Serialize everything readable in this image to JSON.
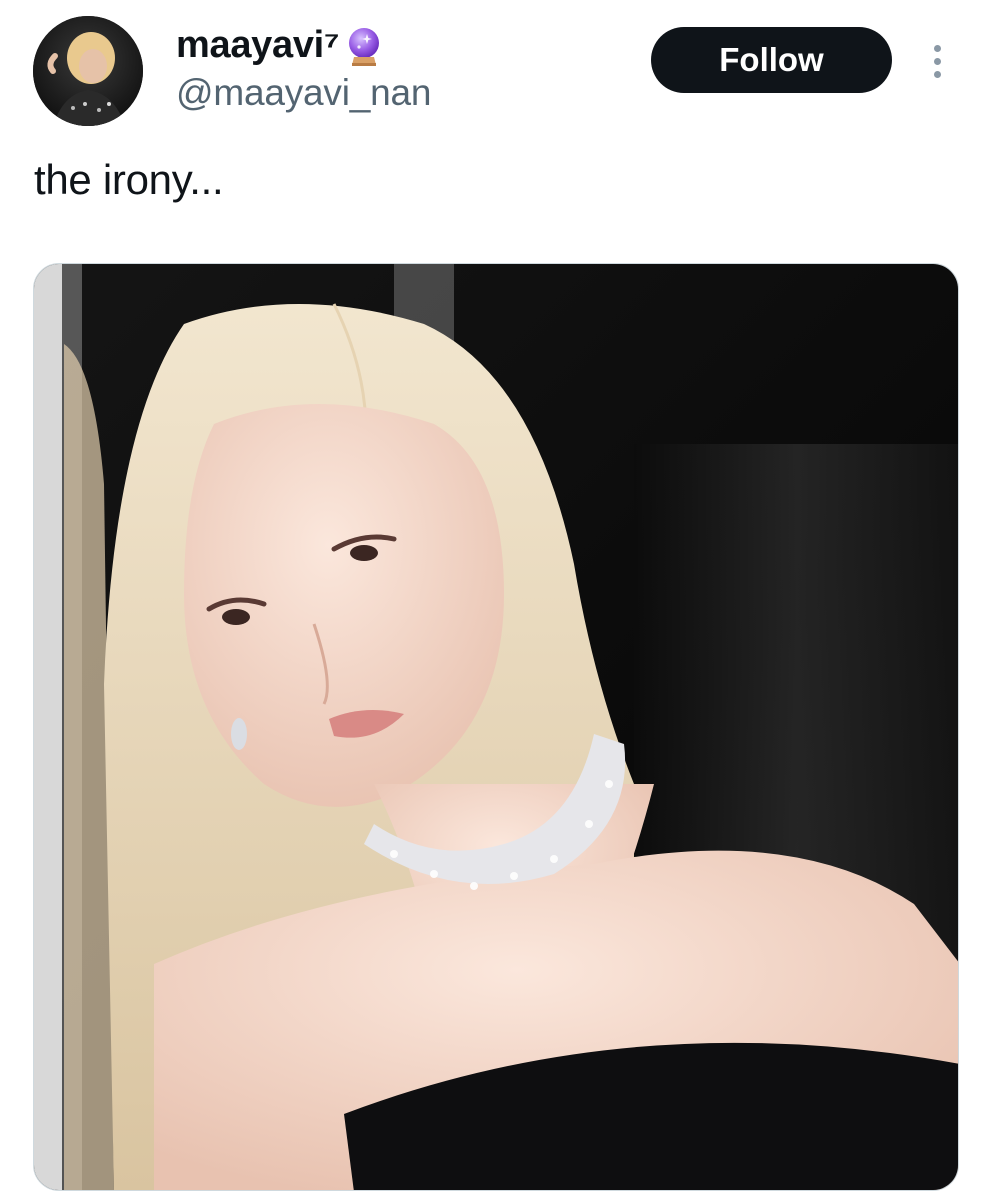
{
  "tweet": {
    "author": {
      "display_name": "maayavi⁷",
      "badge_icon": "crystal-ball-icon",
      "handle": "@maayavi_nan",
      "avatar_icon": "avatar-photo"
    },
    "follow_label": "Follow",
    "more_icon": "more-vertical-icon",
    "text": "the irony...",
    "media": {
      "type": "photo"
    }
  },
  "colors": {
    "text_primary": "#0f1419",
    "text_secondary": "#536471",
    "follow_bg": "#0f1419",
    "follow_text": "#ffffff",
    "badge_purple": "#8a4fd8"
  }
}
